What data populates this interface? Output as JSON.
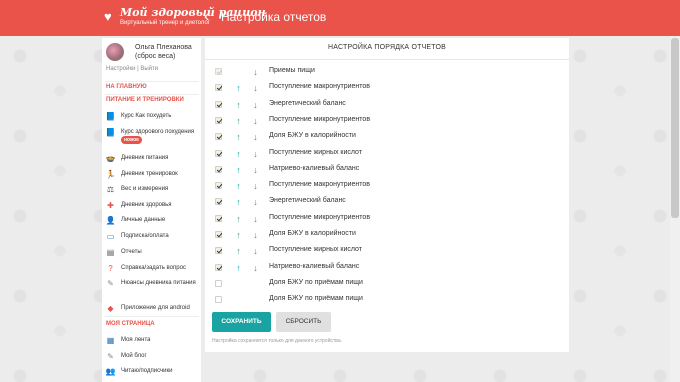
{
  "header": {
    "logo_title": "Мой здоровый рацион",
    "logo_subtitle": "Виртуальный тренер и диетолог",
    "back_icon": "chevron-left-icon",
    "page_title": "Настройка отчетов"
  },
  "sidebar": {
    "user_name": "Ольга Плеханова (сброс веса)",
    "settings_link": "Настройки",
    "separator": "|",
    "logout_link": "Выйти",
    "main_link": "НА ГЛАВНУЮ",
    "section_nutrition": "ПИТАНИЕ И ТРЕНИРОВКИ",
    "section_my_page": "МОЯ СТРАНИЦА",
    "items": [
      {
        "label": "Курс Как похудеть",
        "icon": "book-icon"
      },
      {
        "label": "Курс здорового похудения",
        "badge": "новое",
        "icon": "book-icon"
      },
      {
        "label": "Дневник питания",
        "icon": "food-icon"
      },
      {
        "label": "Дневник тренировок",
        "icon": "running-icon"
      },
      {
        "label": "Вес и измерения",
        "icon": "scale-icon"
      },
      {
        "label": "Дневник здоровья",
        "icon": "health-icon"
      },
      {
        "label": "Личные данные",
        "icon": "user-icon"
      },
      {
        "label": "Подписка/оплата",
        "icon": "card-icon"
      },
      {
        "label": "Отчеты",
        "icon": "chart-icon"
      },
      {
        "label": "Справка/задать вопрос",
        "icon": "question-icon"
      },
      {
        "label": "Нюансы дневника питания",
        "icon": "notes-icon"
      },
      {
        "label": "Приложение для android",
        "icon": "android-icon"
      }
    ],
    "my_page_items": [
      {
        "label": "Моя лента",
        "icon": "feed-icon"
      },
      {
        "label": "Мой блог",
        "icon": "blog-icon"
      },
      {
        "label": "Читаю/подписчики",
        "icon": "people-icon"
      }
    ]
  },
  "panel": {
    "title": "НАСТРОЙКА ПОРЯДКА ОТЧЕТОВ",
    "rows": [
      {
        "label": "Приемы пищи",
        "checked": true,
        "disabled": true,
        "up": false,
        "down": true
      },
      {
        "label": "Поступление макронутриентов",
        "checked": true,
        "disabled": false,
        "up": true,
        "down": true
      },
      {
        "label": "Энергетический баланс",
        "checked": true,
        "disabled": false,
        "up": true,
        "down": true
      },
      {
        "label": "Поступление микронутриентов",
        "checked": true,
        "disabled": false,
        "up": true,
        "down": true
      },
      {
        "label": "Доля БЖУ в калорийности",
        "checked": true,
        "disabled": false,
        "up": true,
        "down": true
      },
      {
        "label": "Поступление жирных кислот",
        "checked": true,
        "disabled": false,
        "up": true,
        "down": true
      },
      {
        "label": "Натриево-калиевый баланс",
        "checked": true,
        "disabled": false,
        "up": true,
        "down": true
      },
      {
        "label": "Поступление макронутриентов",
        "checked": true,
        "disabled": false,
        "up": true,
        "down": true
      },
      {
        "label": "Энергетический баланс",
        "checked": true,
        "disabled": false,
        "up": true,
        "down": true
      },
      {
        "label": "Поступление микронутриентов",
        "checked": true,
        "disabled": false,
        "up": true,
        "down": true
      },
      {
        "label": "Доля БЖУ в калорийности",
        "checked": true,
        "disabled": false,
        "up": true,
        "down": true
      },
      {
        "label": "Поступление жирных кислот",
        "checked": true,
        "disabled": false,
        "up": true,
        "down": true
      },
      {
        "label": "Натриево-калиевый баланс",
        "checked": true,
        "disabled": false,
        "up": true,
        "down": true
      },
      {
        "label": "Доля БЖУ по приёмам пищи",
        "checked": false,
        "disabled": false,
        "up": false,
        "down": false
      },
      {
        "label": "Доля БЖУ по приёмам пищи",
        "checked": false,
        "disabled": false,
        "up": false,
        "down": false
      }
    ],
    "save_label": "СОХРАНИТЬ",
    "reset_label": "СБРОСИТЬ",
    "note": "Настройка сохраняется только для данного устройства."
  },
  "colors": {
    "accent": "#e9534a",
    "teal": "#1aa3a3"
  }
}
